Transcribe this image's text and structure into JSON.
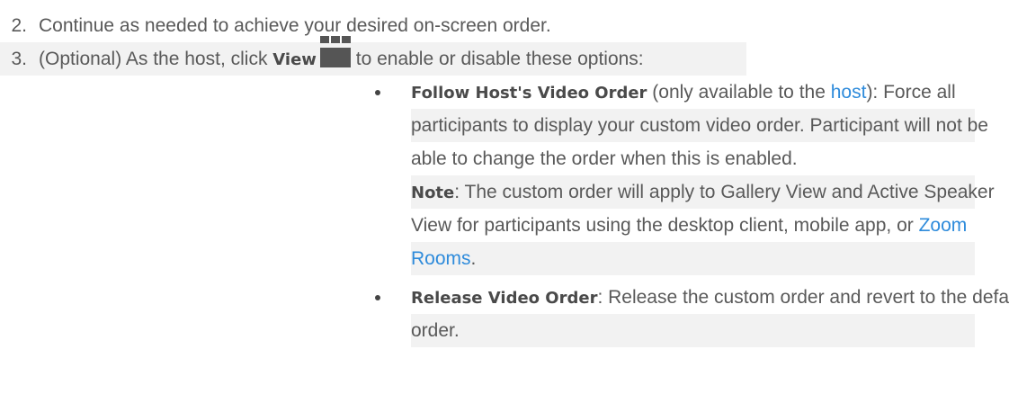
{
  "steps": [
    {
      "number": "2.",
      "text": "Continue as needed to achieve your desired on-screen order."
    },
    {
      "number": "3.",
      "prefix": "(Optional) As the host, click ",
      "bold": "View",
      "suffix": " to enable or disable these options:"
    }
  ],
  "icons": {
    "view": "gallery-view-icon"
  },
  "bullets": [
    {
      "label": "Follow Host's Video Order",
      "line1_mid": " (only available to the ",
      "line1_link": "host",
      "line1_end": "): Force all",
      "line2": "participants to display your custom video order. Participant will not be",
      "line3": "able to change the order when this is enabled.",
      "note_label": "Note",
      "note_line1": ": The custom order will apply to Gallery View and Active Speaker",
      "note_line2": "View for participants using the desktop client, mobile app, or ",
      "note_link_a": "Zoom",
      "note_link_b": "Rooms",
      "note_end": "."
    },
    {
      "label": "Release Video Order",
      "line1_end": ": Release the custom order and revert to the default",
      "line2": "order."
    }
  ],
  "colors": {
    "text": "#595959",
    "link": "#2e8bdb",
    "shade": "#f2f2f2"
  }
}
